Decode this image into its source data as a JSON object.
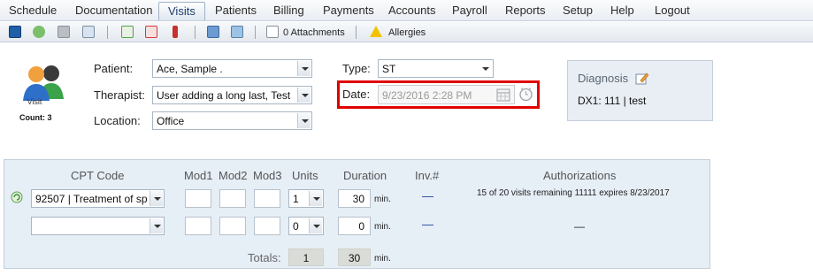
{
  "menu": {
    "items": [
      "Schedule",
      "Documentation",
      "Visits",
      "Patients",
      "Billing",
      "Payments",
      "Accounts",
      "Payroll",
      "Reports",
      "Setup",
      "Help",
      "Logout"
    ],
    "active": "Visits"
  },
  "toolbar": {
    "icons": [
      "save-icon",
      "refresh-icon",
      "print-icon",
      "edit-note-icon",
      "approve-icon",
      "delete-icon",
      "sign-icon",
      "people-icon",
      "image-icon",
      "attachment-icon",
      "warning-icon"
    ],
    "attachments_label": "0 Attachments",
    "allergies_label": "Allergies"
  },
  "visit": {
    "icon_label": "Visit",
    "count_label": "Count: 3"
  },
  "form": {
    "patient_label": "Patient:",
    "patient_value": "Ace, Sample  .",
    "therapist_label": "Therapist:",
    "therapist_value": "User adding a long last, Test",
    "location_label": "Location:",
    "location_value": "Office",
    "type_label": "Type:",
    "type_value": "ST",
    "date_label": "Date:",
    "date_value": "9/23/2016 2:28 PM"
  },
  "diagnosis": {
    "title": "Diagnosis",
    "line": "DX1: 111 | test"
  },
  "cpt_table": {
    "headers": {
      "cpt_code": "CPT Code",
      "mod1": "Mod1",
      "mod2": "Mod2",
      "mod3": "Mod3",
      "units": "Units",
      "duration": "Duration",
      "inv": "Inv.#",
      "authorizations": "Authorizations"
    },
    "rows": [
      {
        "cpt": "92507 | Treatment of sp",
        "mod1": "",
        "mod2": "",
        "mod3": "",
        "units": "1",
        "duration": "30",
        "unit_label": "min.",
        "inv": "—",
        "auth": "15 of 20 visits remaining 11111 expires 8/23/2017"
      },
      {
        "cpt": "",
        "mod1": "",
        "mod2": "",
        "mod3": "",
        "units": "0",
        "duration": "0",
        "unit_label": "min.",
        "inv": "—",
        "auth": "—"
      }
    ],
    "totals_label": "Totals:",
    "totals_units": "1",
    "totals_duration": "30",
    "totals_unit_label": "min."
  },
  "colors": {
    "accent_red": "#e00000",
    "panel_bg": "#e6eef6",
    "link_blue": "#1c3f94"
  }
}
